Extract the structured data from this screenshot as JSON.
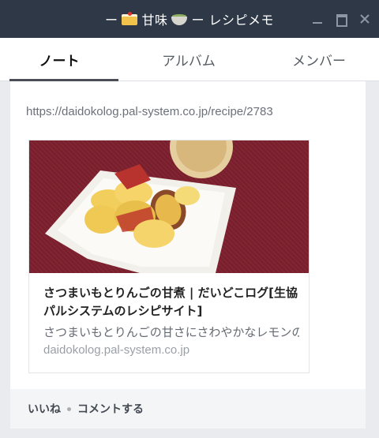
{
  "window": {
    "title_prefix": "ー",
    "title_main": "甘味",
    "title_suffix": "ー レシピメモ",
    "cake_emoji": "cake-icon",
    "tea_emoji": "tea-bowl-icon"
  },
  "tabs": [
    {
      "label": "ノート",
      "active": true
    },
    {
      "label": "アルバム",
      "active": false
    },
    {
      "label": "メンバー",
      "active": false
    }
  ],
  "post": {
    "url": "https://daidokolog.pal-system.co.jp/recipe/2783",
    "card": {
      "title": "さつまいもとりんごの甘煮 | だいどこログ[生協パルシステムのレシピサイト]",
      "description": "さつまいもとりんごの甘さにさわやかなレモンの風...",
      "domain": "daidokolog.pal-system.co.jp"
    },
    "actions": {
      "like": "いいね",
      "comment": "コメントする"
    }
  },
  "colors": {
    "titlebar": "#2e3846",
    "background": "#e9ebef",
    "tab_active_underline": "#4a4f57"
  }
}
